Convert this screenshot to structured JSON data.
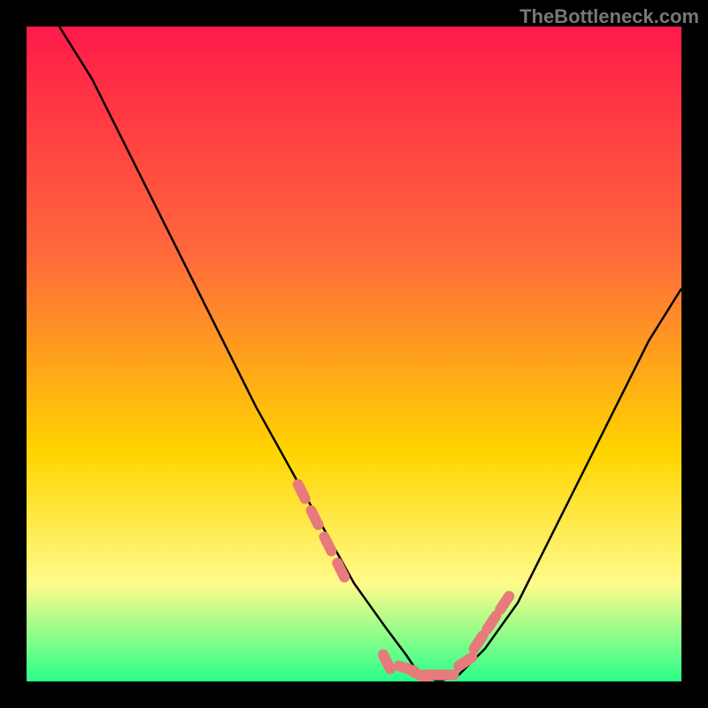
{
  "watermark": "TheBottleneck.com",
  "chart_data": {
    "type": "line",
    "title": "",
    "xlabel": "",
    "ylabel": "",
    "xlim": [
      0,
      100
    ],
    "ylim": [
      0,
      100
    ],
    "gradient_colors": {
      "top": "#ff1a4a",
      "mid1": "#ff6a3a",
      "mid2": "#ffd400",
      "mid3": "#fffb8a",
      "bottom": "#2aff8a"
    },
    "series": [
      {
        "name": "bottleneck-curve",
        "x": [
          5,
          10,
          15,
          20,
          25,
          30,
          35,
          40,
          45,
          50,
          55,
          58,
          60,
          63,
          66,
          70,
          75,
          80,
          85,
          90,
          95,
          100
        ],
        "y": [
          100,
          92,
          82,
          72,
          62,
          52,
          42,
          33,
          24,
          15,
          8,
          4,
          1,
          0,
          1,
          5,
          12,
          22,
          32,
          42,
          52,
          60
        ]
      }
    ],
    "markers": {
      "name": "highlight-points",
      "color": "#e77a7a",
      "x": [
        42,
        44,
        46,
        48,
        55,
        58,
        60,
        62,
        64,
        67,
        69,
        71,
        73
      ],
      "y": [
        29,
        25,
        21,
        17,
        3,
        2,
        1,
        1,
        1,
        3,
        6,
        9,
        12
      ]
    }
  }
}
